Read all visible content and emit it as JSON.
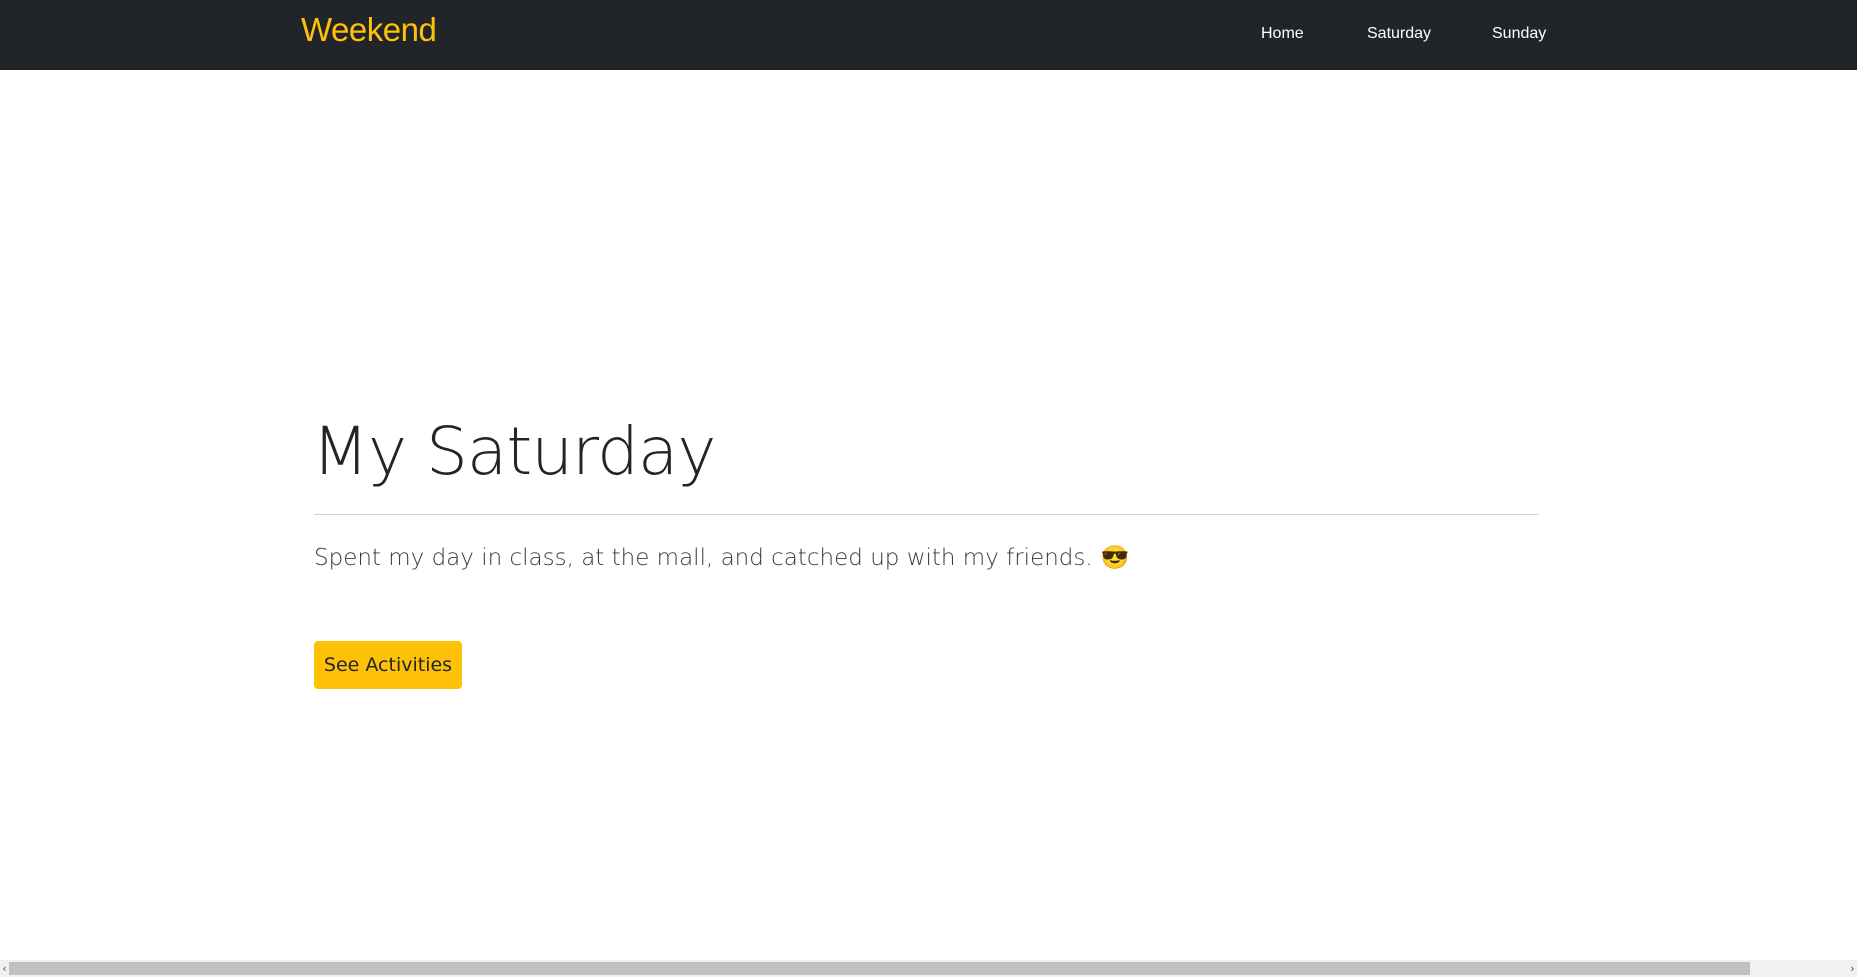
{
  "navbar": {
    "brand": "Weekend",
    "links": [
      {
        "label": "Home"
      },
      {
        "label": "Saturday"
      },
      {
        "label": "Sunday"
      }
    ]
  },
  "hero": {
    "title": "My Saturday",
    "lead": "Spent my day in class, at the mall, and catched up with my friends.",
    "emoji": "😎",
    "button_label": "See Activities"
  },
  "scrollbar": {
    "left_arrow": "‹",
    "right_arrow": "›"
  },
  "colors": {
    "navbar_bg": "#212529",
    "brand": "#ffc107",
    "accent_button": "#ffc107",
    "text_dark": "#212529"
  }
}
